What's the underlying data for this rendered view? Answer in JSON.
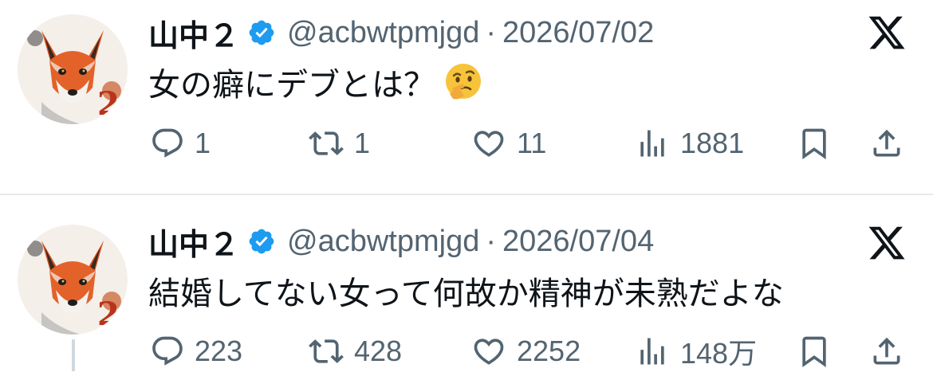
{
  "tweets": [
    {
      "author": {
        "name": "山中２",
        "handle": "@acbwtpmjgd",
        "verified": true,
        "avatar": "fox-avatar"
      },
      "separator": "·",
      "date": "2026/07/02",
      "text": "女の癖にデブとは？",
      "emoji": "thinking-face-emoji",
      "stats": {
        "replies": "1",
        "retweets": "1",
        "likes": "11",
        "views": "1881"
      }
    },
    {
      "author": {
        "name": "山中２",
        "handle": "@acbwtpmjgd",
        "verified": true,
        "avatar": "fox-avatar"
      },
      "separator": "·",
      "date": "2026/07/04",
      "text": "結婚してない女って何故か精神が未熟だよな",
      "stats": {
        "replies": "223",
        "retweets": "428",
        "likes": "2252",
        "views": "148万"
      }
    }
  ],
  "colors": {
    "text": "#0f1419",
    "secondary": "#536471",
    "verified": "#1d9bf0",
    "divider": "#e6e9eb"
  },
  "icons": [
    "reply-icon",
    "retweet-icon",
    "like-icon",
    "views-icon",
    "bookmark-icon",
    "share-icon",
    "x-logo-icon",
    "verified-badge-icon"
  ]
}
